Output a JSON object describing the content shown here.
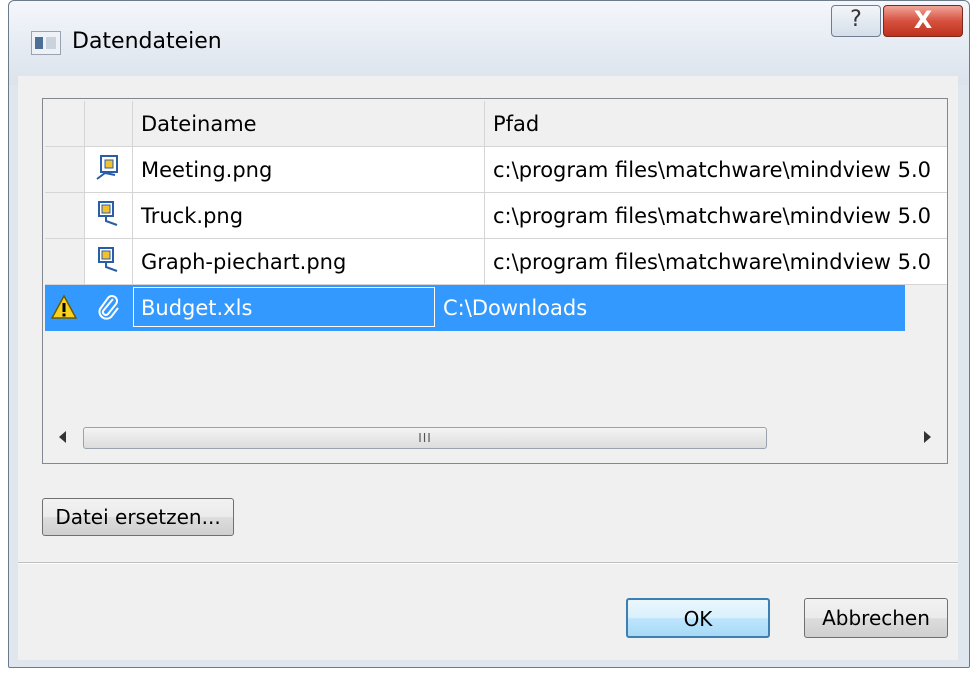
{
  "window": {
    "title": "Datendateien",
    "help_label": "?",
    "close_label": "X"
  },
  "grid": {
    "columns": [
      "",
      "",
      "Dateiname",
      "Pfad"
    ],
    "rows": [
      {
        "status_icon": "",
        "type_icon": "image-file-icon",
        "name": "Meeting.png",
        "path": "c:\\program files\\matchware\\mindview 5.0"
      },
      {
        "status_icon": "",
        "type_icon": "image-file-icon",
        "name": "Truck.png",
        "path": "c:\\program files\\matchware\\mindview 5.0"
      },
      {
        "status_icon": "",
        "type_icon": "image-file-icon",
        "name": "Graph-piechart.png",
        "path": "c:\\program files\\matchware\\mindview 5.0"
      },
      {
        "status_icon": "warning-icon",
        "type_icon": "paperclip-icon",
        "name": "Budget.xls",
        "path": "C:\\Downloads",
        "selected": true
      }
    ],
    "scroll_grip": "III"
  },
  "buttons": {
    "replace_label": "Datei ersetzen...",
    "ok_label": "OK",
    "cancel_label": "Abbrechen"
  },
  "colors": {
    "selection": "#3399ff",
    "warning": "#f7d11e"
  }
}
